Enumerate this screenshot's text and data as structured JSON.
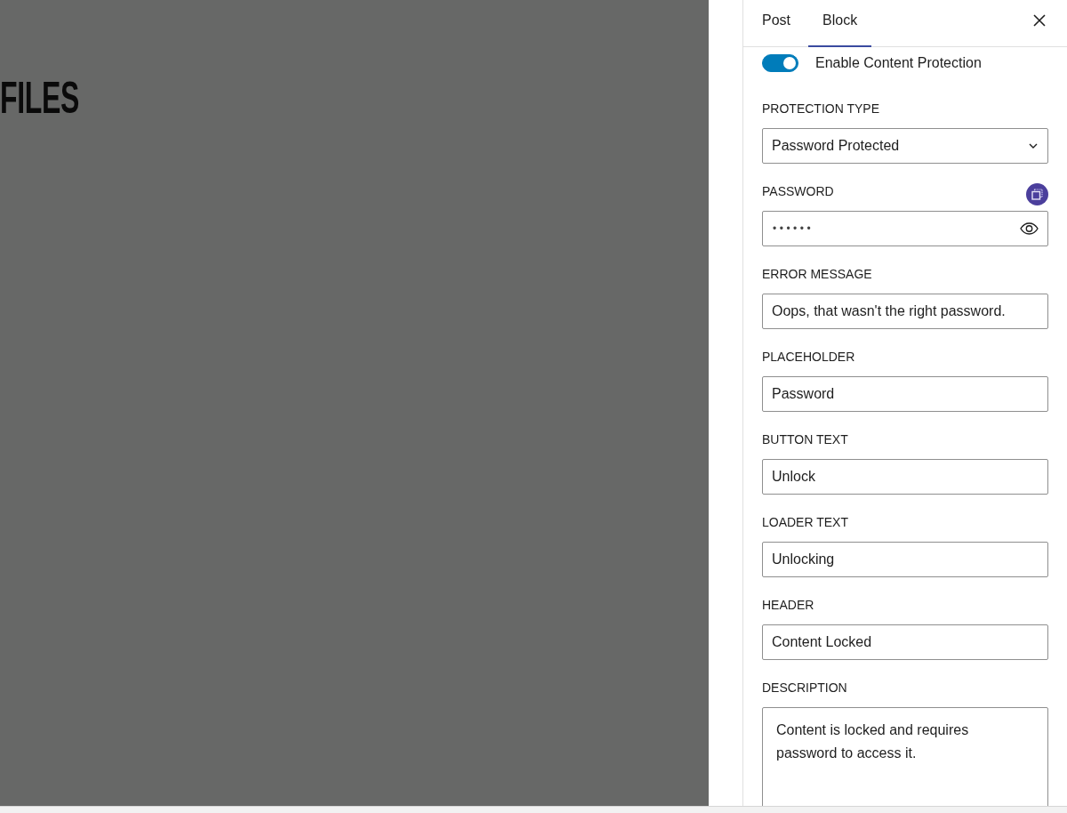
{
  "canvas": {
    "heading": "FILES"
  },
  "sidebar": {
    "tabs": [
      {
        "label": "Post",
        "selected": false
      },
      {
        "label": "Block",
        "selected": true
      }
    ],
    "toggle": {
      "label": "Enable Content Protection",
      "on": true
    },
    "fields": [
      {
        "kind": "select",
        "label": "PROTECTION TYPE",
        "value": "Password Protected"
      },
      {
        "kind": "password",
        "label": "PASSWORD",
        "value": "••••••"
      },
      {
        "kind": "text",
        "label": "ERROR MESSAGE",
        "value": "Oops, that wasn't the right password."
      },
      {
        "kind": "text",
        "label": "PLACEHOLDER",
        "value": "Password"
      },
      {
        "kind": "text",
        "label": "BUTTON TEXT",
        "value": "Unlock"
      },
      {
        "kind": "text",
        "label": "LOADER TEXT",
        "value": "Unlocking"
      },
      {
        "kind": "text",
        "label": "HEADER",
        "value": "Content Locked"
      },
      {
        "kind": "textarea",
        "label": "DESCRIPTION",
        "value": "Content is locked and requires password to access it."
      }
    ]
  }
}
